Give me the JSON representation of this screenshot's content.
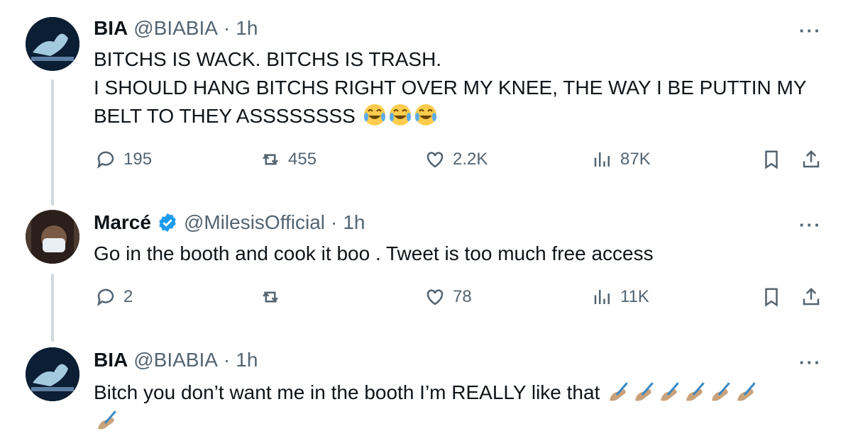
{
  "tweets": [
    {
      "name": "BIA",
      "handle": "@BIABIA",
      "sep": "·",
      "time": "1h",
      "more": "···",
      "lines": [
        "BITCHS IS WACK. BITCHS IS TRASH.",
        "I SHOULD HANG BITCHS RIGHT OVER MY KNEE, THE WAY I BE PUTTIN MY",
        "BELT TO THEY ASSSSSSSS"
      ],
      "reply_count": "195",
      "retweet_count": "455",
      "like_count": "2.2K",
      "view_count": "87K"
    },
    {
      "name": "Marcé",
      "handle": "@MilesisOfficial",
      "sep": "·",
      "time": "1h",
      "more": "···",
      "lines": [
        "Go in the booth and cook it boo . Tweet is too much free access"
      ],
      "reply_count": "2",
      "retweet_count": "",
      "like_count": "78",
      "view_count": "11K"
    },
    {
      "name": "BIA",
      "handle": "@BIABIA",
      "sep": "·",
      "time": "1h",
      "more": "···",
      "lines": [
        "Bitch you don’t want me in the booth I’m REALLY like that"
      ]
    }
  ],
  "icons": {
    "laugh": "face-with-tears-of-joy-icon",
    "writing": "writing-hand-icon",
    "verified_color": "#1d9bf0"
  }
}
